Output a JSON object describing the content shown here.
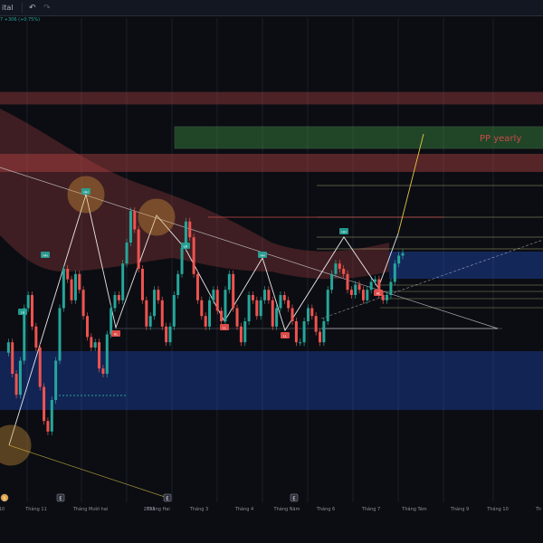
{
  "toolbar": {
    "symbol_suffix": "ital",
    "undo_icon": "undo-icon",
    "redo_icon": "redo-icon"
  },
  "quote_text": "7 +306 (+0.75%)",
  "colors": {
    "background": "#0b0d12",
    "bull_candle": "#26a69a",
    "bear_candle": "#ef5350",
    "red_zone": "#c74b4b",
    "blue_zone": "#2962ff",
    "green_zone": "#4caf50",
    "pp_line": "#e6c74a",
    "white_line": "#d1d4dc"
  },
  "chart_data": {
    "type": "candlestick",
    "title": "",
    "x_axis_ticks": [
      "10",
      "Tháng 11",
      "Tháng Mười hai",
      "2023",
      "Tháng Hai",
      "Tháng 3",
      "Tháng 4",
      "Tháng Năm",
      "Tháng 6",
      "Tháng 7",
      "Tháng Tám",
      "Tháng 9",
      "Tháng 10",
      "Th"
    ],
    "annotation": "PP yearly",
    "axis_event_markers": [
      "S",
      "E",
      "E",
      "E"
    ],
    "grid": true,
    "series": [
      {
        "name": "",
        "close": [
          38,
          42,
          30,
          22,
          35,
          55,
          60,
          48,
          40,
          25,
          12,
          8,
          20,
          35,
          55,
          70,
          66,
          58,
          68,
          62,
          52,
          44,
          40,
          42,
          32,
          30,
          45,
          55,
          60,
          58,
          72,
          80,
          92,
          85,
          70,
          58,
          48,
          52,
          62,
          58,
          48,
          42,
          48,
          60,
          68,
          78,
          88,
          82,
          68,
          58,
          52,
          48,
          58,
          62,
          54,
          50,
          62,
          68,
          55,
          48,
          42,
          50,
          60,
          58,
          52,
          58,
          62,
          58,
          48,
          55,
          60,
          58,
          55,
          50,
          42,
          42,
          50,
          55,
          52,
          46,
          42,
          50,
          62,
          68,
          72,
          70,
          68,
          62,
          60,
          64,
          62,
          58,
          62,
          65,
          66,
          60,
          58,
          60,
          65,
          72,
          75,
          76
        ]
      }
    ],
    "labels": [
      "HH",
      "HL",
      "LH",
      "LL"
    ]
  }
}
